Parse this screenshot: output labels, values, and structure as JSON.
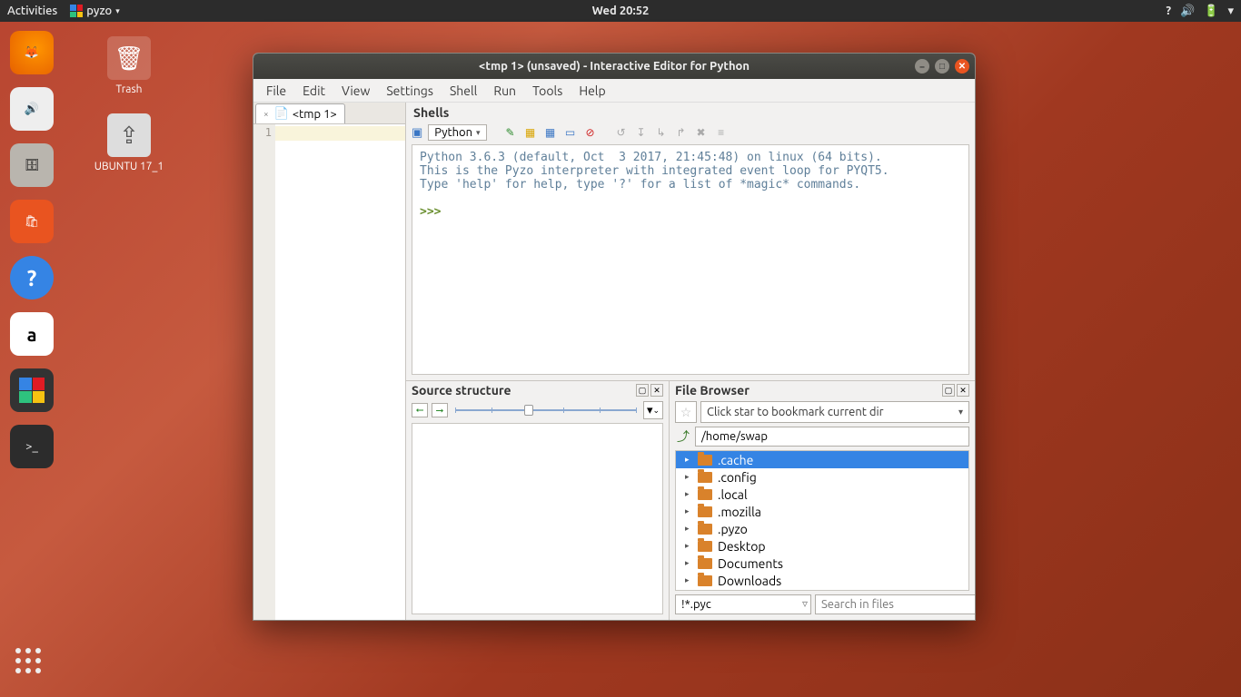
{
  "topbar": {
    "activities": "Activities",
    "app_name": "pyzo",
    "clock": "Wed 20:52"
  },
  "desktop": {
    "trash": "Trash",
    "ubuntu_media": "UBUNTU 17_1"
  },
  "window": {
    "title": "<tmp 1> (unsaved) - Interactive Editor for Python",
    "menu": [
      "File",
      "Edit",
      "View",
      "Settings",
      "Shell",
      "Run",
      "Tools",
      "Help"
    ],
    "editor_tab": "<tmp 1>",
    "gutter_line": "1"
  },
  "shells": {
    "title": "Shells",
    "dropdown": "Python",
    "output_lines": [
      "Python 3.6.3 (default, Oct  3 2017, 21:45:48) on linux (64 bits).",
      "This is the Pyzo interpreter with integrated event loop for PYQT5.",
      "Type 'help' for help, type '?' for a list of *magic* commands.",
      ""
    ],
    "prompt": ">>> "
  },
  "structure": {
    "title": "Source structure"
  },
  "filebrowser": {
    "title": "File Browser",
    "bookmark_placeholder": "Click star to bookmark current dir",
    "path": "/home/swap",
    "items": [
      {
        "name": ".cache",
        "selected": true
      },
      {
        "name": ".config"
      },
      {
        "name": ".local"
      },
      {
        "name": ".mozilla"
      },
      {
        "name": ".pyzo"
      },
      {
        "name": "Desktop"
      },
      {
        "name": "Documents"
      },
      {
        "name": "Downloads"
      }
    ],
    "filter_value": "!*.pyc",
    "search_placeholder": "Search in files"
  }
}
